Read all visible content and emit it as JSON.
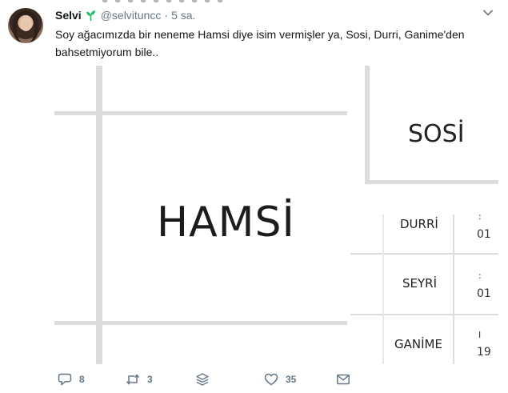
{
  "tweet": {
    "author_name": "Selvi",
    "handle": "@selvituncc",
    "separator": "·",
    "time": "5 sa.",
    "text": "Soy ağacımızda bir neneme Hamsi diye isim vermişler ya, Sosi, Durri, Ganime'den bahsetmiyorum bile.."
  },
  "media": {
    "left_word": "HAMSİ",
    "right_title": "SOSİ",
    "rows": [
      {
        "name": "DURRİ",
        "val_top": ":",
        "val_bottom": "01"
      },
      {
        "name": "SEYRİ",
        "val_top": ":",
        "val_bottom": "01"
      },
      {
        "name": "GANİME",
        "val_top": "I",
        "val_bottom": "19"
      }
    ]
  },
  "actions": {
    "reply_count": "8",
    "retweet_count": "3",
    "like_count": "35"
  },
  "colors": {
    "muted": "#657786",
    "text": "#14171a",
    "grid": "#dcdcdc",
    "accent": "#17bf63"
  }
}
